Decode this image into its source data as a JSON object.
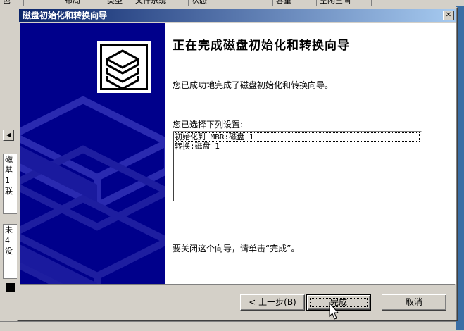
{
  "background": {
    "header_cols": [
      "邑",
      "布局",
      "类型",
      "文件系统",
      "状态",
      "容量",
      "空闲空间"
    ],
    "tile1_text": "磁\n基\n1'\n联",
    "tile2_text": "未\n4\n没"
  },
  "dialog": {
    "title": "磁盘初始化和转换向导",
    "close_glyph": "✕"
  },
  "wizard": {
    "heading": "正在完成磁盘初始化和转换向导",
    "success_text": "您已成功地完成了磁盘初始化和转换向导。",
    "selection_label": "您已选择下列设置:",
    "settings": [
      "初始化到 MBR:磁盘 1",
      "转换:磁盘 1"
    ],
    "close_instruction": "要关闭这个向导，请单击“完成”。"
  },
  "buttons": {
    "back_label": "< 上一步(B)",
    "finish_label": "完成",
    "cancel_label": "取消"
  },
  "colors": {
    "titlebar_start": "#0a246a",
    "side_panel": "#00008b"
  }
}
